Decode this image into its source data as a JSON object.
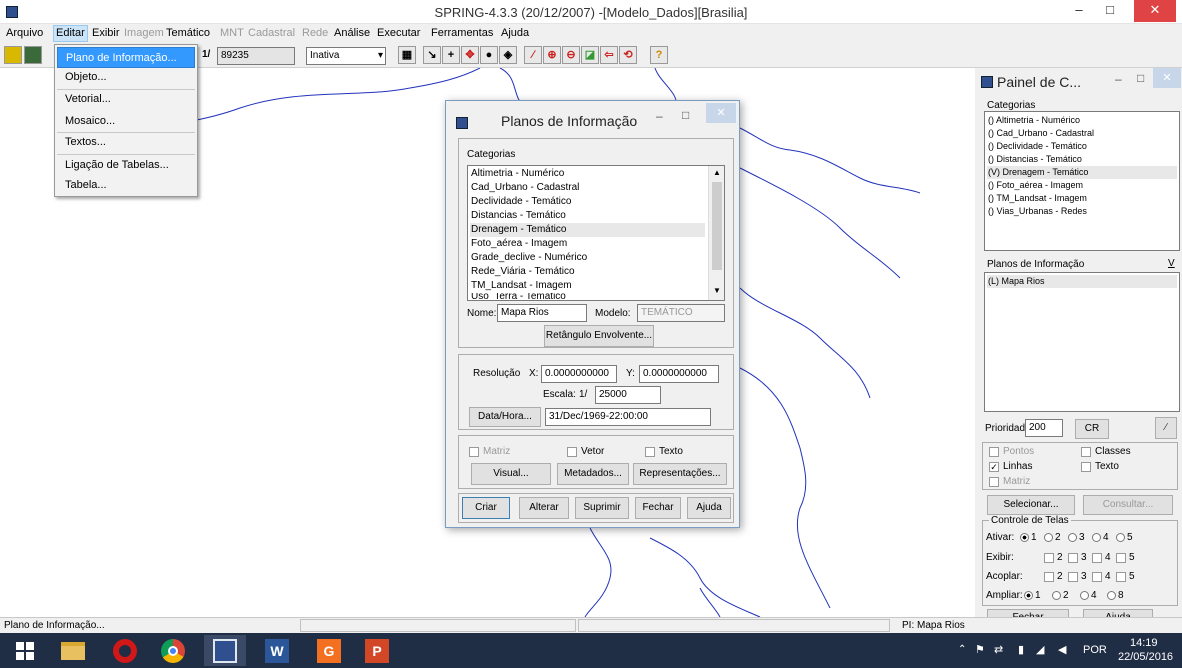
{
  "window": {
    "title": "SPRING-4.3.3 (20/12/2007) -[Modelo_Dados][Brasilia]",
    "min": "–",
    "max": "□",
    "close": "✕"
  },
  "menu": [
    "Arquivo",
    "Editar",
    "Exibir",
    "Imagem",
    "Temático",
    "MNT",
    "Cadastral",
    "Rede",
    "Análise",
    "Executar",
    "Ferramentas",
    "Ajuda"
  ],
  "toolbar": {
    "scale_prefix": "1/",
    "scale_value": "89235",
    "mode_value": "Inativa"
  },
  "dropdown": [
    "Plano de Informação...",
    "Objeto...",
    "Vetorial...",
    "Mosaico...",
    "Textos...",
    "Ligação de Tabelas...",
    "Tabela..."
  ],
  "dialog": {
    "title": "Planos de Informação",
    "categorias_label": "Categorias",
    "categorias": [
      "Altimetria - Numérico",
      "Cad_Urbano - Cadastral",
      "Declividade - Temático",
      "Distancias - Temático",
      "Drenagem - Temático",
      "Foto_aérea - Imagem",
      "Grade_declive - Numérico",
      "Rede_Viária - Temático",
      "TM_Landsat - Imagem",
      "Uso_Terra - Temático"
    ],
    "nome_label": "Nome:",
    "nome_value": "Mapa Rios",
    "modelo_label": "Modelo:",
    "modelo_value": "TEMÁTICO",
    "retangulo_button": "Retângulo Envolvente...",
    "resolucao_label": "Resolução",
    "x_label": "X:",
    "x_value": "0.0000000000",
    "y_label": "Y:",
    "y_value": "0.0000000000",
    "escala_label": "Escala:",
    "escala_prefix": "1/",
    "escala_value": "25000",
    "datahora_button": "Data/Hora...",
    "datahora_value": "31/Dec/1969-22:00:00",
    "matriz": "Matriz",
    "vetor": "Vetor",
    "texto": "Texto",
    "visual_button": "Visual...",
    "metadados_button": "Metadados...",
    "representacoes_button": "Representações...",
    "criar": "Criar",
    "alterar": "Alterar",
    "suprimir": "Suprimir",
    "fechar": "Fechar",
    "ajuda": "Ajuda"
  },
  "panel": {
    "title": "Painel de C...",
    "categorias_label": "Categorias",
    "categorias": [
      "() Altimetria - Numérico",
      "() Cad_Urbano - Cadastral",
      "() Declividade - Temático",
      "() Distancias - Temático",
      "(V) Drenagem - Temático",
      "() Foto_aérea - Imagem",
      "() TM_Landsat - Imagem",
      "() Vias_Urbanas - Redes"
    ],
    "planos_label": "Planos de Informação",
    "planos_v": "V",
    "planos": [
      "(L) Mapa Rios"
    ],
    "prioridade_label": "Prioridade:",
    "prioridade_value": "200",
    "cr_button": "CR",
    "pontos": "Pontos",
    "classes": "Classes",
    "linhas": "Linhas",
    "texto": "Texto",
    "matriz": "Matriz",
    "selecionar_button": "Selecionar...",
    "consultar_button": "Consultar...",
    "controle_label": "Controle de Telas",
    "ativar_label": "Ativar:",
    "exibir_label": "Exibir:",
    "acoplar_label": "Acoplar:",
    "ampliar_label": "Ampliar:",
    "n1": "1",
    "n2": "2",
    "n3": "3",
    "n4": "4",
    "n5": "5",
    "n8": "8",
    "fechar_button": "Fechar",
    "ajuda_button": "Ajuda"
  },
  "status": {
    "left": "Plano de Informação...",
    "pi": "PI: Mapa Rios"
  },
  "taskbar": {
    "lang": "POR",
    "time": "14:19",
    "date": "22/05/2016"
  }
}
